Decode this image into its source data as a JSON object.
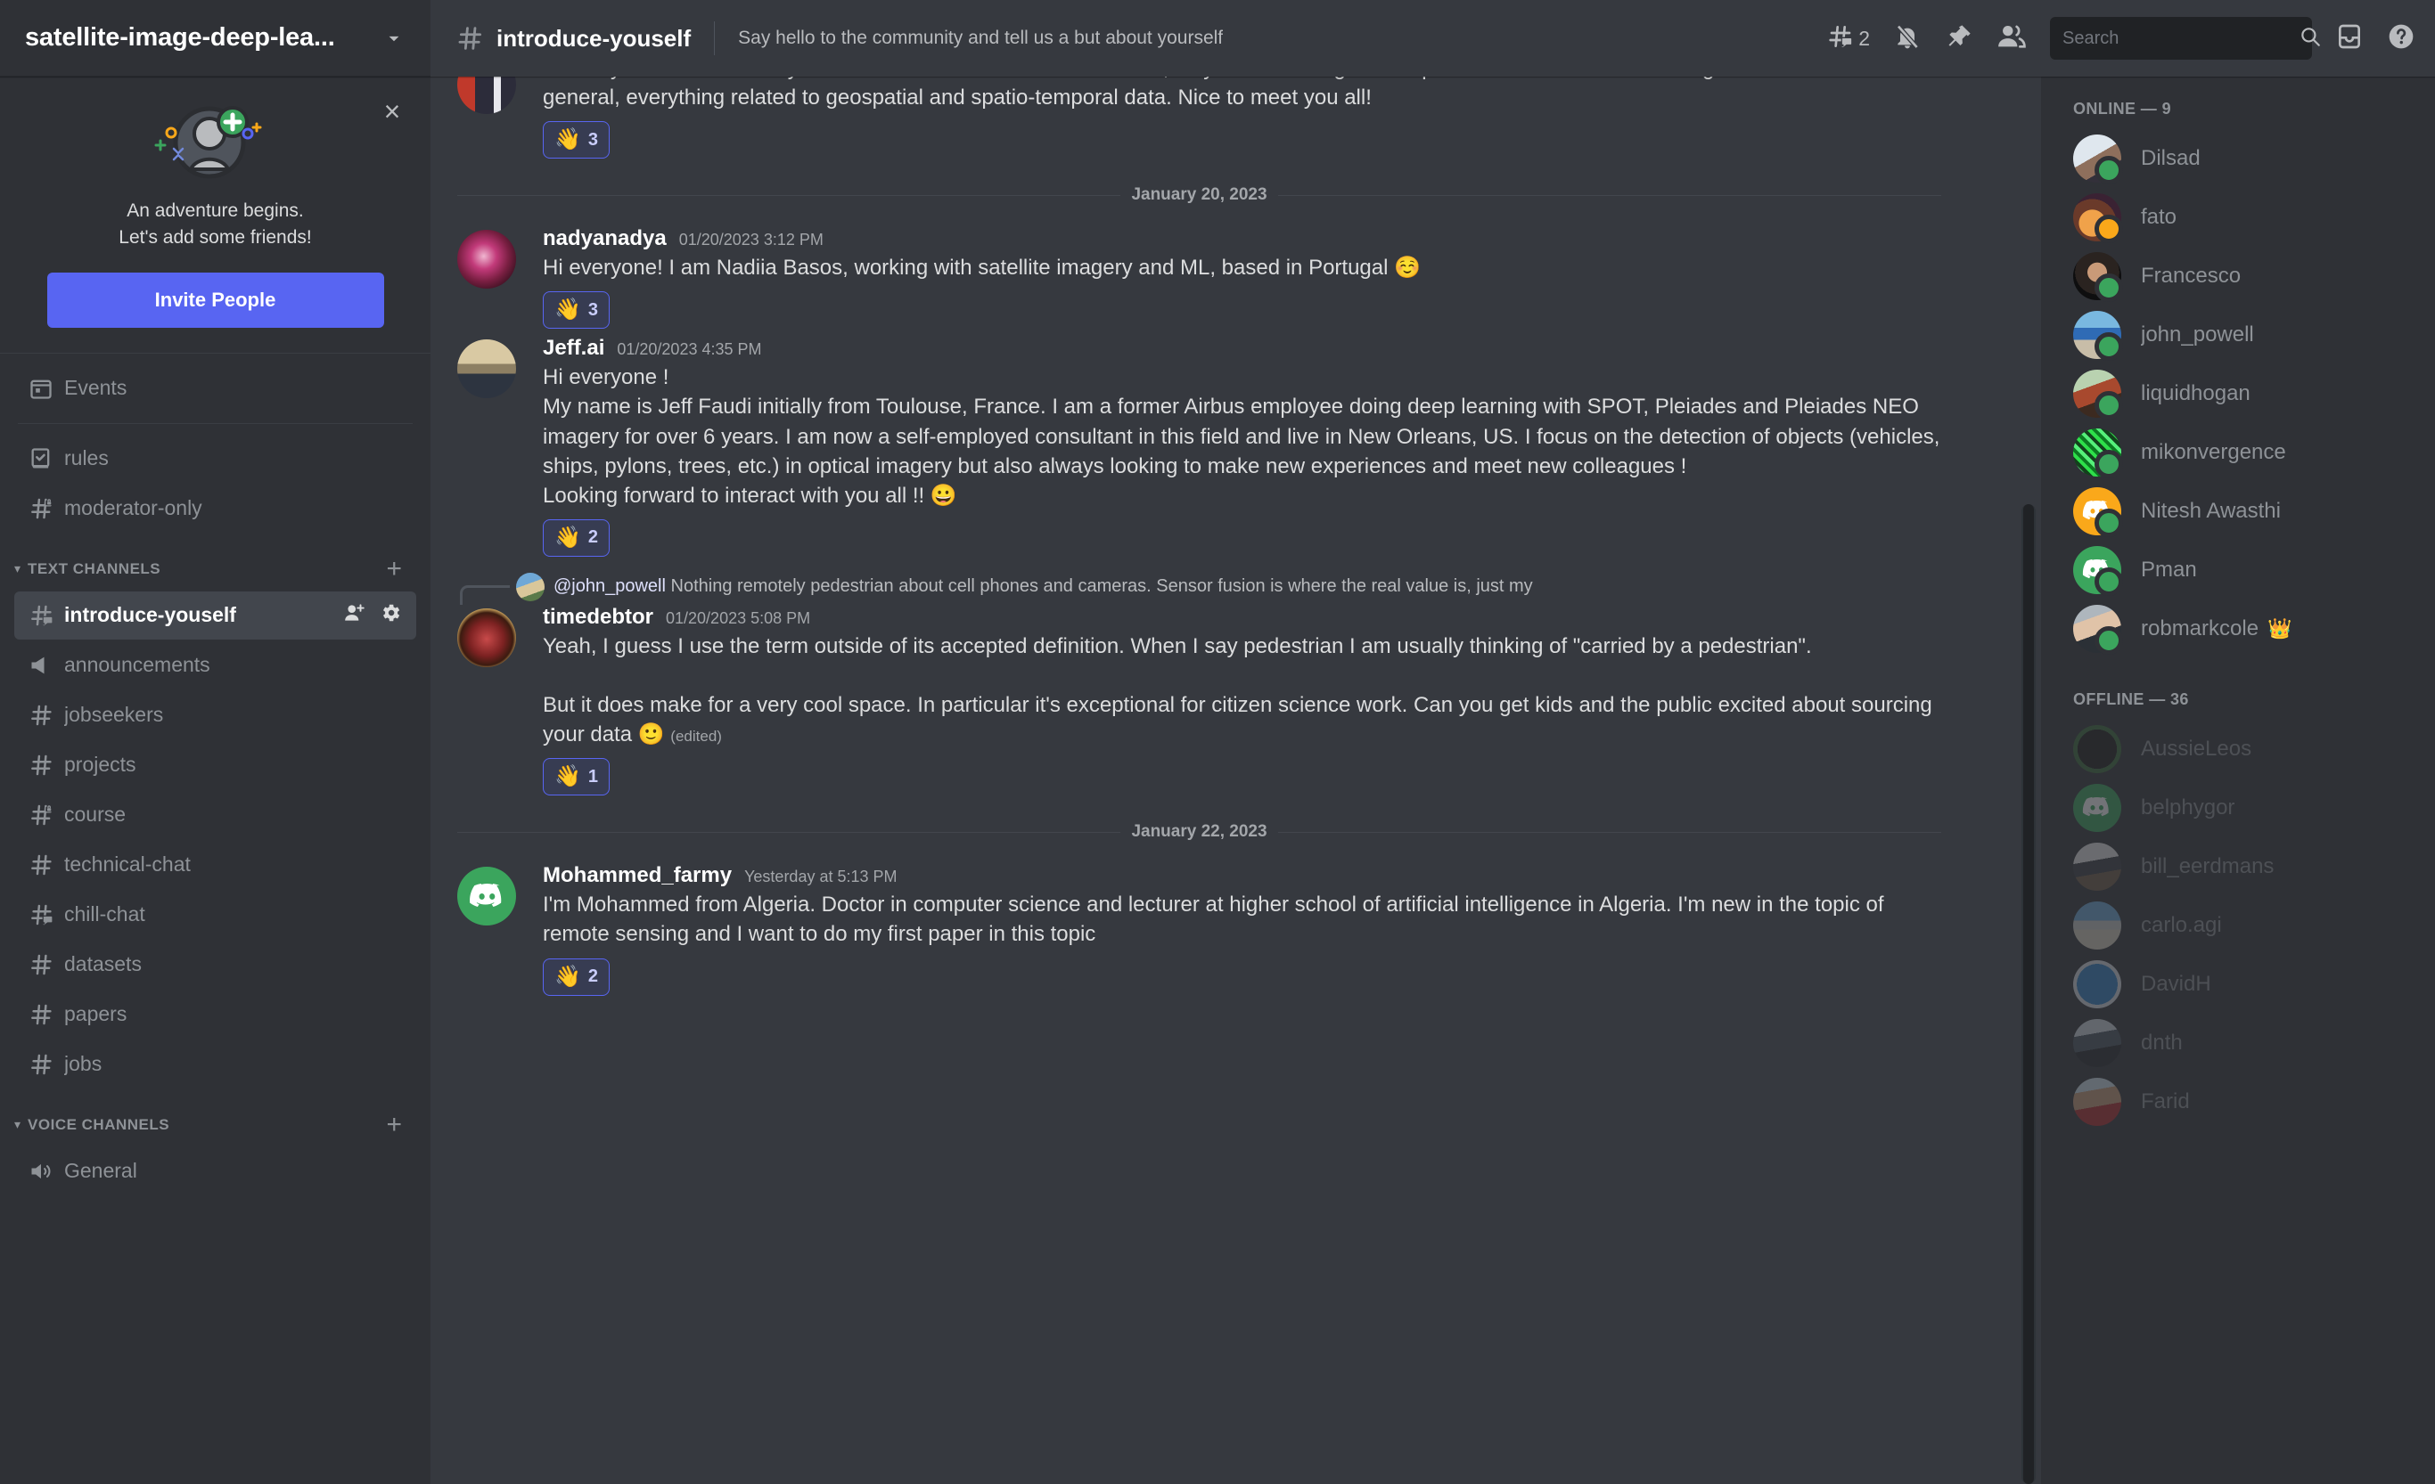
{
  "server": {
    "name": "satellite-image-deep-lea...",
    "chevron_icon": "chevron-down-icon"
  },
  "promo": {
    "close_icon": "close-icon",
    "line1": "An adventure begins.",
    "line2": "Let's add some friends!",
    "invite_label": "Invite People"
  },
  "sidebar": {
    "events": {
      "label": "Events",
      "icon": "calendar-icon"
    },
    "top_channels": [
      {
        "label": "rules",
        "icon": "rules-book-icon"
      },
      {
        "label": "moderator-only",
        "icon": "hash-lock-icon"
      }
    ],
    "text_category": {
      "label": "TEXT CHANNELS",
      "add_icon": "plus-icon",
      "caret_icon": "chevron-down-icon"
    },
    "text_channels": [
      {
        "label": "introduce-youself",
        "icon": "hash-thread-icon",
        "active": true,
        "actions": [
          "add-member-icon",
          "gear-icon"
        ]
      },
      {
        "label": "announcements",
        "icon": "megaphone-icon"
      },
      {
        "label": "jobseekers",
        "icon": "hash-icon"
      },
      {
        "label": "projects",
        "icon": "hash-icon"
      },
      {
        "label": "course",
        "icon": "hash-lock-icon"
      },
      {
        "label": "technical-chat",
        "icon": "hash-icon"
      },
      {
        "label": "chill-chat",
        "icon": "hash-thread-icon"
      },
      {
        "label": "datasets",
        "icon": "hash-icon"
      },
      {
        "label": "papers",
        "icon": "hash-icon"
      },
      {
        "label": "jobs",
        "icon": "hash-icon"
      }
    ],
    "voice_category": {
      "label": "VOICE CHANNELS",
      "add_icon": "plus-icon",
      "caret_icon": "chevron-down-icon"
    },
    "voice_channels": [
      {
        "label": "General",
        "icon": "speaker-icon"
      }
    ]
  },
  "header": {
    "hash_icon": "hash-icon",
    "channel": "introduce-youself",
    "topic": "Say hello to the community and tell us a but about yourself",
    "threads_icon": "threads-icon",
    "threads_count": "2",
    "bell_icon": "bell-muted-icon",
    "pin_icon": "pin-icon",
    "members_icon": "members-icon",
    "search_placeholder": "Search",
    "search_value": "",
    "search_icon": "search-icon",
    "inbox_icon": "inbox-icon",
    "help_icon": "help-icon"
  },
  "messages": [
    {
      "type": "continuation",
      "text": "Hi everyone! I am currently a PhD Student at Politecnico di Torino, Italy. I am working on computer vision for remote sensing data and more in general, everything related to geospatial and spatio-temporal data. Nice to meet you all!",
      "reactions": [
        {
          "emoji": "👋",
          "count": "3"
        }
      ]
    },
    {
      "type": "date-separator",
      "label": "January 20, 2023"
    },
    {
      "type": "message",
      "author": "nadyanadya",
      "timestamp": "01/20/2023 3:12 PM",
      "text": "Hi everyone! I am Nadiia Basos, working with satellite imagery and ML, based in Portugal ☺️",
      "reactions": [
        {
          "emoji": "👋",
          "count": "3"
        }
      ]
    },
    {
      "type": "message",
      "author": "Jeff.ai",
      "timestamp": "01/20/2023 4:35 PM",
      "text": "Hi everyone !\nMy name is Jeff Faudi initially from Toulouse, France. I am a former Airbus employee doing deep learning with SPOT, Pleiades and Pleiades NEO imagery for over 6 years. I am now a self-employed consultant in this field and live in New Orleans, US. I focus on the detection of objects (vehicles, ships, pylons, trees, etc.) in optical imagery but also always looking to make new experiences and meet new colleagues !\nLooking forward to interact with you all !! 😀",
      "reactions": [
        {
          "emoji": "👋",
          "count": "2"
        }
      ]
    },
    {
      "type": "message",
      "author": "timedebtor",
      "timestamp": "01/20/2023 5:08 PM",
      "reply_to_author": "@john_powell",
      "reply_to_text": "Nothing remotely pedestrian about cell phones and cameras. Sensor fusion is where the real value is, just my",
      "text": "Yeah, I guess I use the term outside of its accepted definition. When I say pedestrian I am usually thinking of \"carried by a pedestrian\".\n\nBut it does make for a very cool space. In particular it's exceptional for citizen science work. Can you get kids and the public excited about sourcing your data 🙂",
      "edited_label": "(edited)",
      "reactions": [
        {
          "emoji": "👋",
          "count": "1"
        }
      ]
    },
    {
      "type": "date-separator",
      "label": "January 22, 2023"
    },
    {
      "type": "message",
      "author": "Mohammed_farmy",
      "timestamp": "Yesterday at 5:13 PM",
      "text": "I'm Mohammed from Algeria. Doctor in computer science and lecturer at higher school of artificial intelligence in Algeria. I'm new in the topic of remote sensing and I want to do my first paper in this topic",
      "reactions": [
        {
          "emoji": "👋",
          "count": "2"
        }
      ]
    }
  ],
  "members": {
    "online_label": "ONLINE — 9",
    "online": [
      {
        "name": "Dilsad",
        "status": "online"
      },
      {
        "name": "fato",
        "status": "idle"
      },
      {
        "name": "Francesco",
        "status": "online"
      },
      {
        "name": "john_powell",
        "status": "online"
      },
      {
        "name": "liquidhogan",
        "status": "online"
      },
      {
        "name": "mikonvergence",
        "status": "online"
      },
      {
        "name": "Nitesh Awasthi",
        "status": "online"
      },
      {
        "name": "Pman",
        "status": "online"
      },
      {
        "name": "robmarkcole",
        "status": "online",
        "badge": "crown-icon"
      }
    ],
    "offline_label": "OFFLINE — 36",
    "offline": [
      {
        "name": "AussieLeos"
      },
      {
        "name": "belphygor"
      },
      {
        "name": "bill_eerdmans"
      },
      {
        "name": "carlo.agi"
      },
      {
        "name": "DavidH"
      },
      {
        "name": "dnth"
      },
      {
        "name": "Farid"
      }
    ]
  },
  "colors": {
    "brand": "#5865f2",
    "sidebar_bg": "#2f3136",
    "chat_bg": "#36393f",
    "online_green": "#3ba55d",
    "idle_yellow": "#faa81a"
  }
}
